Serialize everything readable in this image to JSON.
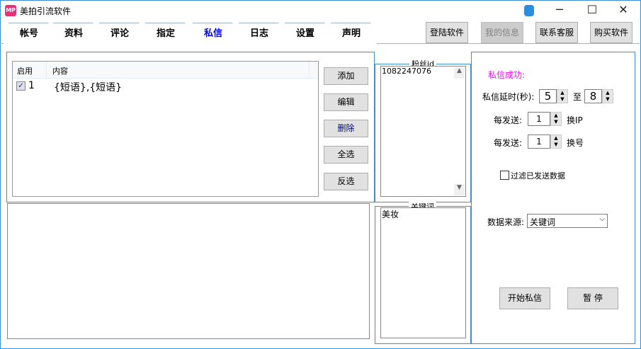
{
  "window": {
    "title": "美拍引流软件",
    "logo": "MP"
  },
  "tabs": [
    "帐号",
    "资料",
    "评论",
    "指定",
    "私信",
    "日志",
    "设置",
    "声明"
  ],
  "active_tab": "私信",
  "toolbar": {
    "login": "登陆软件",
    "my_info": "我的信息",
    "contact": "联系客服",
    "buy": "购买软件"
  },
  "list": {
    "headers": [
      "启用",
      "内容"
    ],
    "rows": [
      {
        "checked": true,
        "index": "1",
        "content": "{短语},{短语}"
      }
    ]
  },
  "side_buttons": {
    "add": "添加",
    "edit": "编辑",
    "delete": "删除",
    "select_all": "全选",
    "invert": "反选"
  },
  "fans": {
    "label": "粉丝id",
    "value": "1082247076"
  },
  "keywords": {
    "label": "关键词",
    "value": "美妆"
  },
  "settings": {
    "status": "私信成功:",
    "delay_label": "私信延时(秒):",
    "delay_min": "5",
    "to": "至",
    "delay_max": "8",
    "every_send": "每发送:",
    "ip_count": "1",
    "change_ip": "换IP",
    "every_send2": "每发送:",
    "acct_count": "1",
    "change_acct": "换号",
    "filter_label": "过滤已发送数据",
    "filter_checked": false,
    "source_label": "数据来源:",
    "source_value": "关键词",
    "start": "开始私信",
    "pause": "暂 停"
  },
  "colors": {
    "accent": "#0000ff",
    "status": "#ff00ff",
    "border": "#3c8fd6"
  }
}
